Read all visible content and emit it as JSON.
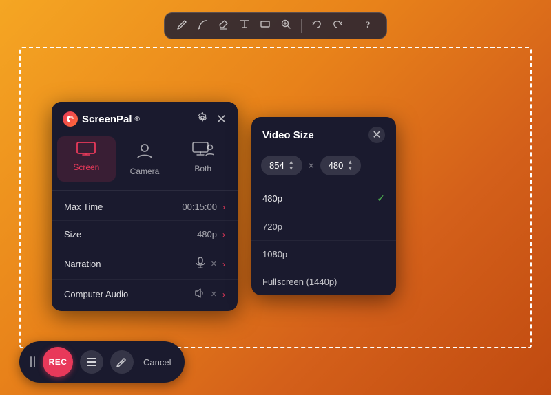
{
  "toolbar": {
    "icons": [
      "pencil",
      "pencil-alt",
      "eraser",
      "text",
      "rectangle",
      "zoom",
      "undo",
      "redo",
      "help"
    ]
  },
  "screenpal": {
    "logo_text": "ScreenPal",
    "logo_trademark": "®",
    "tabs": [
      {
        "id": "screen",
        "label": "Screen",
        "active": true
      },
      {
        "id": "camera",
        "label": "Camera",
        "active": false
      },
      {
        "id": "both",
        "label": "Both",
        "active": false
      }
    ],
    "settings": [
      {
        "label": "Max Time",
        "value": "00:15:00",
        "type": "arrow"
      },
      {
        "label": "Size",
        "value": "480p",
        "type": "arrow"
      },
      {
        "label": "Narration",
        "value": "",
        "type": "mic"
      },
      {
        "label": "Computer Audio",
        "value": "",
        "type": "speaker"
      }
    ]
  },
  "video_size": {
    "title": "Video Size",
    "width": "854",
    "height": "480",
    "options": [
      {
        "label": "480p",
        "selected": true
      },
      {
        "label": "720p",
        "selected": false
      },
      {
        "label": "1080p",
        "selected": false
      },
      {
        "label": "Fullscreen  (1440p)",
        "selected": false
      }
    ]
  },
  "bottom_bar": {
    "rec_label": "REC",
    "cancel_label": "Cancel"
  }
}
